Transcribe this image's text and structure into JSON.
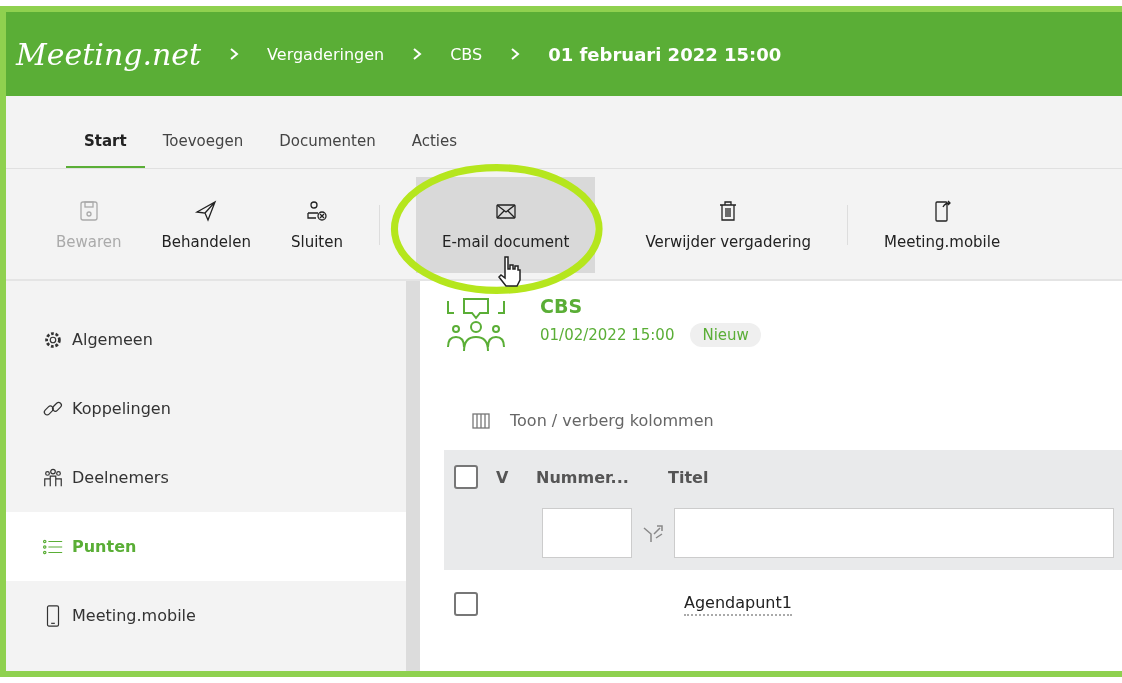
{
  "header": {
    "logo": "Meeting.net",
    "breadcrumbs": [
      "Vergaderingen",
      "CBS"
    ],
    "current": "01 februari 2022 15:00"
  },
  "tabs": [
    {
      "label": "Start",
      "selected": true
    },
    {
      "label": "Toevoegen",
      "selected": false
    },
    {
      "label": "Documenten",
      "selected": false
    },
    {
      "label": "Acties",
      "selected": false
    }
  ],
  "toolbar": [
    {
      "kind": "button",
      "label": "Bewaren",
      "disabled": true,
      "hovered": false
    },
    {
      "kind": "button",
      "label": "Behandelen",
      "disabled": false,
      "hovered": false
    },
    {
      "kind": "button",
      "label": "Sluiten",
      "disabled": false,
      "hovered": false
    },
    {
      "kind": "separator"
    },
    {
      "kind": "button",
      "label": "E-mail document",
      "disabled": false,
      "hovered": true
    },
    {
      "kind": "button",
      "label": "Verwijder vergadering",
      "disabled": false,
      "hovered": false
    },
    {
      "kind": "separator"
    },
    {
      "kind": "button",
      "label": "Meeting.mobile",
      "disabled": false,
      "hovered": false
    }
  ],
  "sidebar": {
    "items": [
      {
        "label": "Algemeen",
        "selected": false
      },
      {
        "label": "Koppelingen",
        "selected": false
      },
      {
        "label": "Deelnemers",
        "selected": false
      },
      {
        "label": "Punten",
        "selected": true
      },
      {
        "label": "Meeting.mobile",
        "selected": false
      }
    ]
  },
  "meeting": {
    "title": "CBS",
    "date": "01/02/2022 15:00",
    "status": "Nieuw"
  },
  "columns_toggle": "Toon / verberg kolommen",
  "table": {
    "columns": [
      "V",
      "Nummer...",
      "Titel"
    ],
    "rows": [
      {
        "checked": false,
        "title": "Agendapunt1"
      }
    ],
    "header_checked": false
  }
}
